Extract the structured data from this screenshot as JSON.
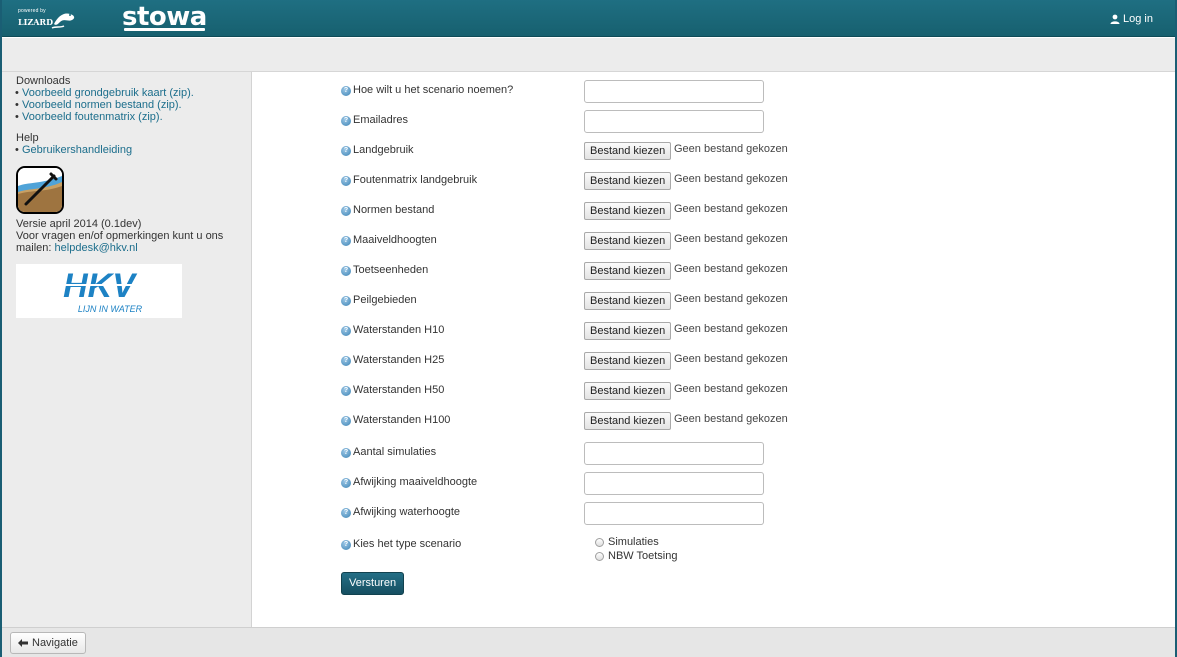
{
  "header": {
    "powered_by": "powered by",
    "lizard_text": "LIZARD",
    "brand": "stowa",
    "login_label": "Log in"
  },
  "sidebar": {
    "downloads_title": "Downloads",
    "downloads": [
      "Voorbeeld grondgebruik kaart (zip).",
      "Voorbeeld normen bestand (zip).",
      "Voorbeeld foutenmatrix (zip)."
    ],
    "help_title": "Help",
    "help_links": [
      "Gebruikershandleiding"
    ],
    "version_text": "Versie april 2014 (0.1dev)",
    "contact_text": "Voor vragen en/of opmerkingen kunt u ons",
    "mail_prefix": "mailen:",
    "mail_link": "helpdesk@hkv.nl",
    "partner_logo_text": "HKV",
    "partner_tagline": "LIJN IN WATER"
  },
  "form": {
    "help_icon": "question-icon",
    "file_button_label": "Bestand kiezen",
    "no_file_text": "Geen bestand gekozen",
    "fields": [
      {
        "label": "Hoe wilt u het scenario noemen?",
        "type": "text",
        "value": ""
      },
      {
        "label": "Emailadres",
        "type": "text",
        "value": ""
      },
      {
        "label": "Landgebruik",
        "type": "file"
      },
      {
        "label": "Foutenmatrix landgebruik",
        "type": "file"
      },
      {
        "label": "Normen bestand",
        "type": "file"
      },
      {
        "label": "Maaiveldhoogten",
        "type": "file"
      },
      {
        "label": "Toetseenheden",
        "type": "file"
      },
      {
        "label": "Peilgebieden",
        "type": "file"
      },
      {
        "label": "Waterstanden H10",
        "type": "file"
      },
      {
        "label": "Waterstanden H25",
        "type": "file"
      },
      {
        "label": "Waterstanden H50",
        "type": "file"
      },
      {
        "label": "Waterstanden H100",
        "type": "file"
      },
      {
        "label": "Aantal simulaties",
        "type": "text",
        "value": ""
      },
      {
        "label": "Afwijking maaiveldhoogte",
        "type": "text",
        "value": ""
      },
      {
        "label": "Afwijking waterhoogte",
        "type": "text",
        "value": ""
      }
    ],
    "scenario_type_label": "Kies het type scenario",
    "scenario_options": [
      "Simulaties",
      "NBW Toetsing"
    ],
    "submit_label": "Versturen"
  },
  "footer": {
    "nav_label": "Navigatie"
  },
  "colors": {
    "header_bg": "#1f6f82",
    "link": "#1c6e8c",
    "submit_bg": "#1a5a6e"
  }
}
